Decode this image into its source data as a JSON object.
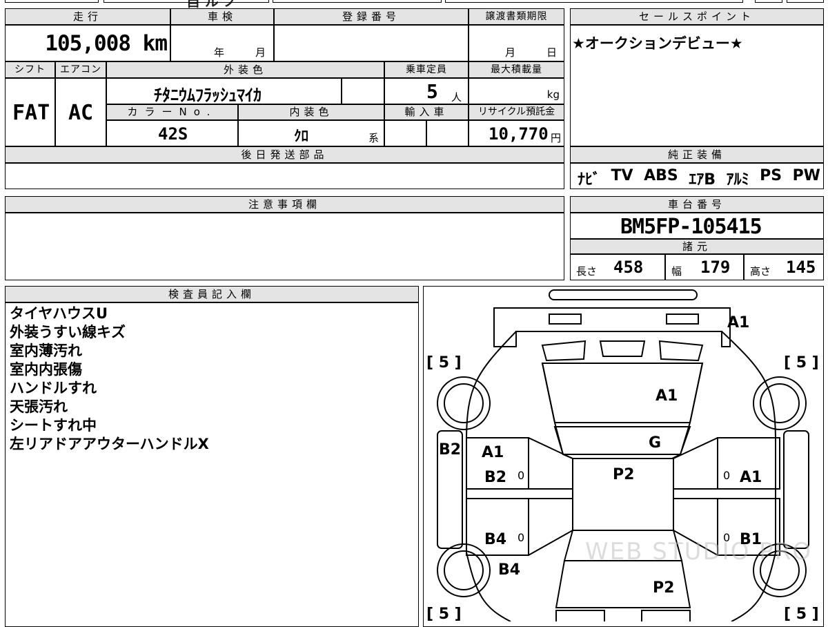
{
  "top_strip": {
    "partial_glyphs": "自 ル ノ"
  },
  "mileage": {
    "label": "走行",
    "value": "105,008 km"
  },
  "shaken": {
    "label": "車検",
    "year": "年",
    "month": "月"
  },
  "registration": {
    "label": "登録番号",
    "value": ""
  },
  "transfer_deadline": {
    "label": "譲渡書類期限",
    "month": "月",
    "day": "日"
  },
  "shift": {
    "label": "シフト",
    "value": "FAT"
  },
  "aircon": {
    "label": "エアコン",
    "value": "AC"
  },
  "exterior_color": {
    "label": "外装色",
    "value": "ﾁﾀﾆｳﾑﾌﾗｯｼｭﾏｲｶ"
  },
  "capacity": {
    "label": "乗車定員",
    "value": "5",
    "unit": "人"
  },
  "max_load": {
    "label": "最大積載量",
    "unit": "kg"
  },
  "color_no": {
    "label": "カラーNo.",
    "value": "42S"
  },
  "interior_color": {
    "label": "内装色",
    "value": "ｸﾛ",
    "suffix": "系"
  },
  "import": {
    "label": "輸入車"
  },
  "recycle": {
    "label": "リサイクル預託金",
    "value": "10,770",
    "unit": "円"
  },
  "later_parts": {
    "label": "後日発送部品"
  },
  "sales_point": {
    "label": "セールスポイント",
    "text": "★オークションデビュー★"
  },
  "equipment": {
    "label": "純正装備",
    "items": [
      "ﾅﾋﾞ",
      "TV",
      "ABS",
      "ｴｱB",
      "ｱﾙﾐ",
      "PS",
      "PW"
    ]
  },
  "caution": {
    "label": "注意事項欄"
  },
  "chassis": {
    "label": "車台番号",
    "value": "BM5FP-105415"
  },
  "specs": {
    "label": "諸元",
    "length_label": "長さ",
    "length": "458",
    "width_label": "幅",
    "width": "179",
    "height_label": "高さ",
    "height": "145"
  },
  "inspector": {
    "label": "検査員記入欄",
    "notes": [
      "タイヤハウスU",
      "外装うすい線キズ",
      "室内薄汚れ",
      "室内内張傷",
      "ハンドルすれ",
      "天張汚れ",
      "シートすれ中",
      "左リアドアアウターハンドルX"
    ]
  },
  "diagram": {
    "tires": {
      "fl": "[ 5 ]",
      "fr": "[ 5 ]",
      "rl": "[ 5 ]",
      "rr": "[ 5 ]"
    },
    "marks": {
      "front_bumper": "A1",
      "hood": "A1",
      "windshield": "G",
      "roof": "P2",
      "left_front_fender": "B2",
      "left_front_door_1": "A1",
      "left_front_door_2": "B2",
      "left_rear_door": "B4",
      "left_rear_fender": "B4",
      "right_front_door": "A1",
      "right_rear_door": "B1",
      "trunk": "P2",
      "left_front_door_zero": "0",
      "left_rear_door_zero": "0",
      "right_front_door_zero": "0",
      "right_rear_door_zero": "0"
    },
    "watermark": "WEB STUDIO PRO"
  }
}
